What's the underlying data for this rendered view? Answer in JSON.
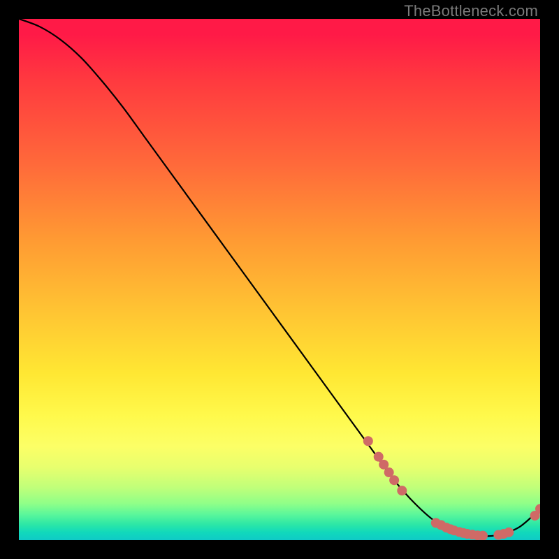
{
  "watermark": "TheBottleneck.com",
  "chart_data": {
    "type": "line",
    "title": "",
    "xlabel": "",
    "ylabel": "",
    "xlim": [
      0,
      100
    ],
    "ylim": [
      0,
      100
    ],
    "grid": false,
    "series": [
      {
        "name": "bottleneck-curve",
        "color": "#000000",
        "x": [
          0,
          4,
          8,
          12,
          16,
          20,
          24,
          28,
          32,
          36,
          40,
          44,
          48,
          52,
          56,
          60,
          64,
          68,
          72,
          76,
          80,
          84,
          88,
          92,
          96,
          100
        ],
        "y": [
          100,
          98.5,
          96,
          92.5,
          88,
          83,
          77.5,
          72,
          66.5,
          61,
          55.5,
          50,
          44.5,
          39,
          33.5,
          28,
          22.5,
          17,
          11.5,
          7,
          3.5,
          1.5,
          0.8,
          1.0,
          2.5,
          6
        ]
      }
    ],
    "markers": {
      "name": "threshold-markers",
      "color": "#cf6a66",
      "radius_px": 7,
      "points": [
        {
          "x": 67,
          "y": 19
        },
        {
          "x": 69,
          "y": 16
        },
        {
          "x": 70,
          "y": 14.5
        },
        {
          "x": 71,
          "y": 13
        },
        {
          "x": 72,
          "y": 11.5
        },
        {
          "x": 73.5,
          "y": 9.5
        },
        {
          "x": 80,
          "y": 3.3
        },
        {
          "x": 81,
          "y": 2.9
        },
        {
          "x": 82,
          "y": 2.4
        },
        {
          "x": 82.8,
          "y": 2.1
        },
        {
          "x": 83.5,
          "y": 1.85
        },
        {
          "x": 84.5,
          "y": 1.55
        },
        {
          "x": 85.3,
          "y": 1.35
        },
        {
          "x": 86,
          "y": 1.2
        },
        {
          "x": 87,
          "y": 1.05
        },
        {
          "x": 88,
          "y": 0.9
        },
        {
          "x": 89,
          "y": 0.85
        },
        {
          "x": 92,
          "y": 1.0
        },
        {
          "x": 93,
          "y": 1.2
        },
        {
          "x": 94,
          "y": 1.5
        },
        {
          "x": 99,
          "y": 4.7
        },
        {
          "x": 100,
          "y": 6
        }
      ]
    }
  }
}
